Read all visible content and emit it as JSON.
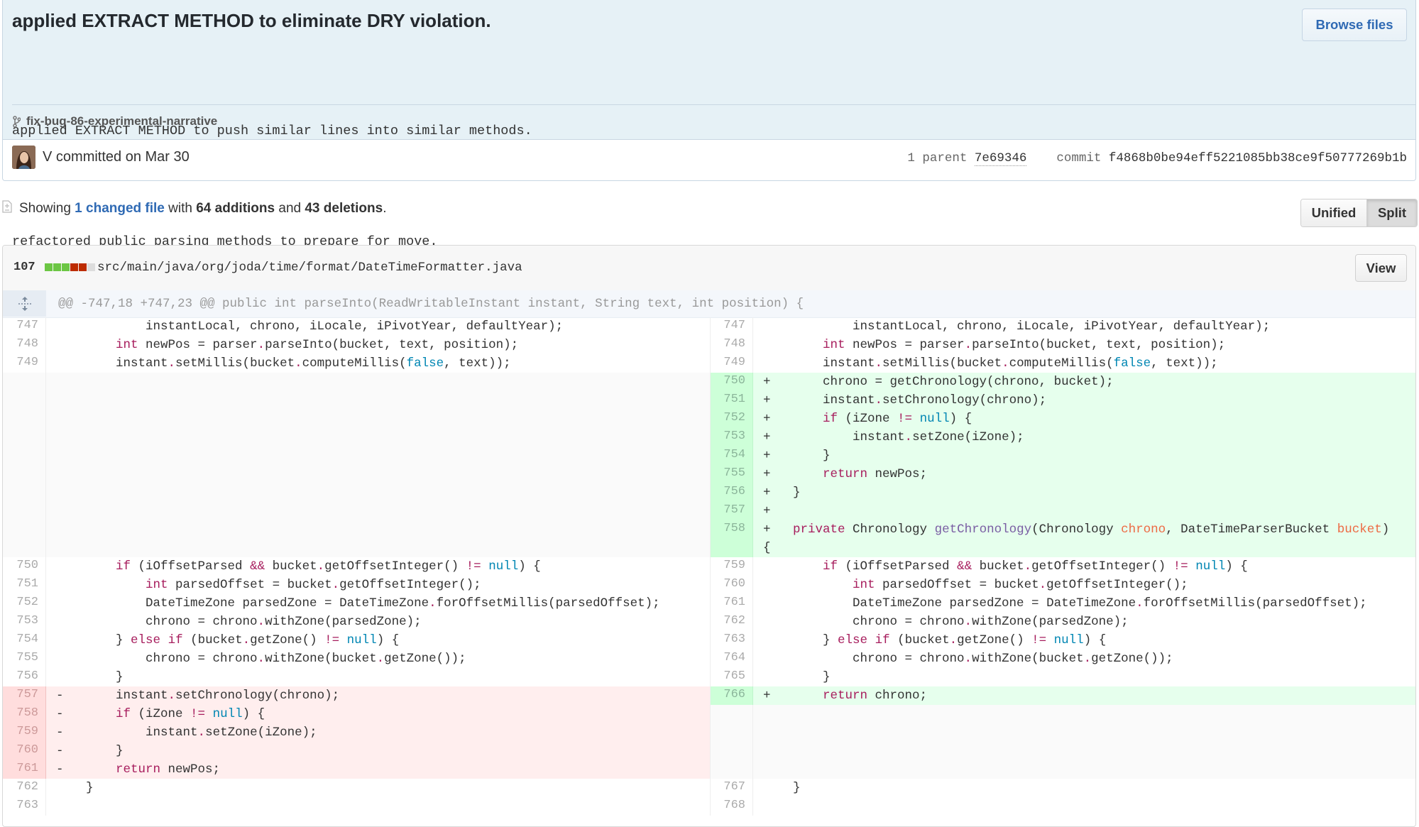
{
  "commit": {
    "title": "applied EXTRACT METHOD to eliminate DRY violation.",
    "description_lines": [
      "applied EXTRACT METHOD to push similar lines into similar methods.",
      "refactored public parsing methods to prepare for move."
    ],
    "browse_files_label": "Browse files",
    "branch": "fix-bug-86-experimental-narrative",
    "author": "V",
    "committed_text": "committed on Mar 30",
    "parent_label": "1 parent",
    "parent_sha": "7e69346",
    "commit_label": "commit",
    "commit_sha": "f4868b0be94eff5221085bb38ce9f50777269b1b"
  },
  "toc": {
    "showing": "Showing",
    "changed_files": "1 changed file",
    "with": "with",
    "additions": "64 additions",
    "and": "and",
    "deletions": "43 deletions",
    "period": "."
  },
  "view_toggle": {
    "unified_label": "Unified",
    "split_label": "Split",
    "selected": "Split"
  },
  "file": {
    "change_count": "107",
    "diffstat": [
      "added",
      "added",
      "added",
      "deleted",
      "deleted",
      "neutral"
    ],
    "path": "src/main/java/org/joda/time/format/DateTimeFormatter.java",
    "view_label": "View",
    "hunk_header": "@@ -747,18 +747,23 @@ public int parseInto(ReadWritableInstant instant, String text, int position) {"
  },
  "colors": {
    "added_line": "#e6ffed",
    "deleted_line": "#ffeeee",
    "link": "#2f6ab4"
  },
  "diff_rows": [
    {
      "type": "context",
      "left_num": "747",
      "right_num": "747",
      "left": "            instantLocal, chrono, iLocale, iPivotYear, defaultYear);",
      "right": "            instantLocal, chrono, iLocale, iPivotYear, defaultYear);"
    },
    {
      "type": "context",
      "left_num": "748",
      "right_num": "748",
      "left": "        int newPos = parser.parseInto(bucket, text, position);",
      "right": "        int newPos = parser.parseInto(bucket, text, position);"
    },
    {
      "type": "context",
      "left_num": "749",
      "right_num": "749",
      "left": "        instant.setMillis(bucket.computeMillis(false, text));",
      "right": "        instant.setMillis(bucket.computeMillis(false, text));"
    },
    {
      "type": "add",
      "left_num": "",
      "right_num": "750",
      "left": "",
      "right": "+       chrono = getChronology(chrono, bucket);"
    },
    {
      "type": "add",
      "left_num": "",
      "right_num": "751",
      "left": "",
      "right": "+       instant.setChronology(chrono);"
    },
    {
      "type": "add",
      "left_num": "",
      "right_num": "752",
      "left": "",
      "right": "+       if (iZone != null) {"
    },
    {
      "type": "add",
      "left_num": "",
      "right_num": "753",
      "left": "",
      "right": "+           instant.setZone(iZone);"
    },
    {
      "type": "add",
      "left_num": "",
      "right_num": "754",
      "left": "",
      "right": "+       }"
    },
    {
      "type": "add",
      "left_num": "",
      "right_num": "755",
      "left": "",
      "right": "+       return newPos;"
    },
    {
      "type": "add",
      "left_num": "",
      "right_num": "756",
      "left": "",
      "right": "+   }"
    },
    {
      "type": "add",
      "left_num": "",
      "right_num": "757",
      "left": "",
      "right": "+"
    },
    {
      "type": "add",
      "left_num": "",
      "right_num": "758",
      "left": "",
      "right": "+   private Chronology getChronology(Chronology chrono, DateTimeParserBucket bucket)",
      "right_cont": "{"
    },
    {
      "type": "context",
      "left_num": "750",
      "right_num": "759",
      "left": "        if (iOffsetParsed && bucket.getOffsetInteger() != null) {",
      "right": "        if (iOffsetParsed && bucket.getOffsetInteger() != null) {"
    },
    {
      "type": "context",
      "left_num": "751",
      "right_num": "760",
      "left": "            int parsedOffset = bucket.getOffsetInteger();",
      "right": "            int parsedOffset = bucket.getOffsetInteger();"
    },
    {
      "type": "context",
      "left_num": "752",
      "right_num": "761",
      "left": "            DateTimeZone parsedZone = DateTimeZone.forOffsetMillis(parsedOffset);",
      "right": "            DateTimeZone parsedZone = DateTimeZone.forOffsetMillis(parsedOffset);"
    },
    {
      "type": "context",
      "left_num": "753",
      "right_num": "762",
      "left": "            chrono = chrono.withZone(parsedZone);",
      "right": "            chrono = chrono.withZone(parsedZone);"
    },
    {
      "type": "context",
      "left_num": "754",
      "right_num": "763",
      "left": "        } else if (bucket.getZone() != null) {",
      "right": "        } else if (bucket.getZone() != null) {"
    },
    {
      "type": "context",
      "left_num": "755",
      "right_num": "764",
      "left": "            chrono = chrono.withZone(bucket.getZone());",
      "right": "            chrono = chrono.withZone(bucket.getZone());"
    },
    {
      "type": "context",
      "left_num": "756",
      "right_num": "765",
      "left": "        }",
      "right": "        }"
    },
    {
      "type": "mixed",
      "left_num": "757",
      "right_num": "766",
      "left": "-       instant.setChronology(chrono);",
      "right": "+       return chrono;"
    },
    {
      "type": "del",
      "left_num": "758",
      "right_num": "",
      "left": "-       if (iZone != null) {",
      "right": ""
    },
    {
      "type": "del",
      "left_num": "759",
      "right_num": "",
      "left": "-           instant.setZone(iZone);",
      "right": ""
    },
    {
      "type": "del",
      "left_num": "760",
      "right_num": "",
      "left": "-       }",
      "right": ""
    },
    {
      "type": "del",
      "left_num": "761",
      "right_num": "",
      "left": "-       return newPos;",
      "right": ""
    },
    {
      "type": "context",
      "left_num": "762",
      "right_num": "767",
      "left": "    }",
      "right": "    }"
    },
    {
      "type": "context",
      "left_num": "763",
      "right_num": "768",
      "left": "",
      "right": ""
    }
  ]
}
